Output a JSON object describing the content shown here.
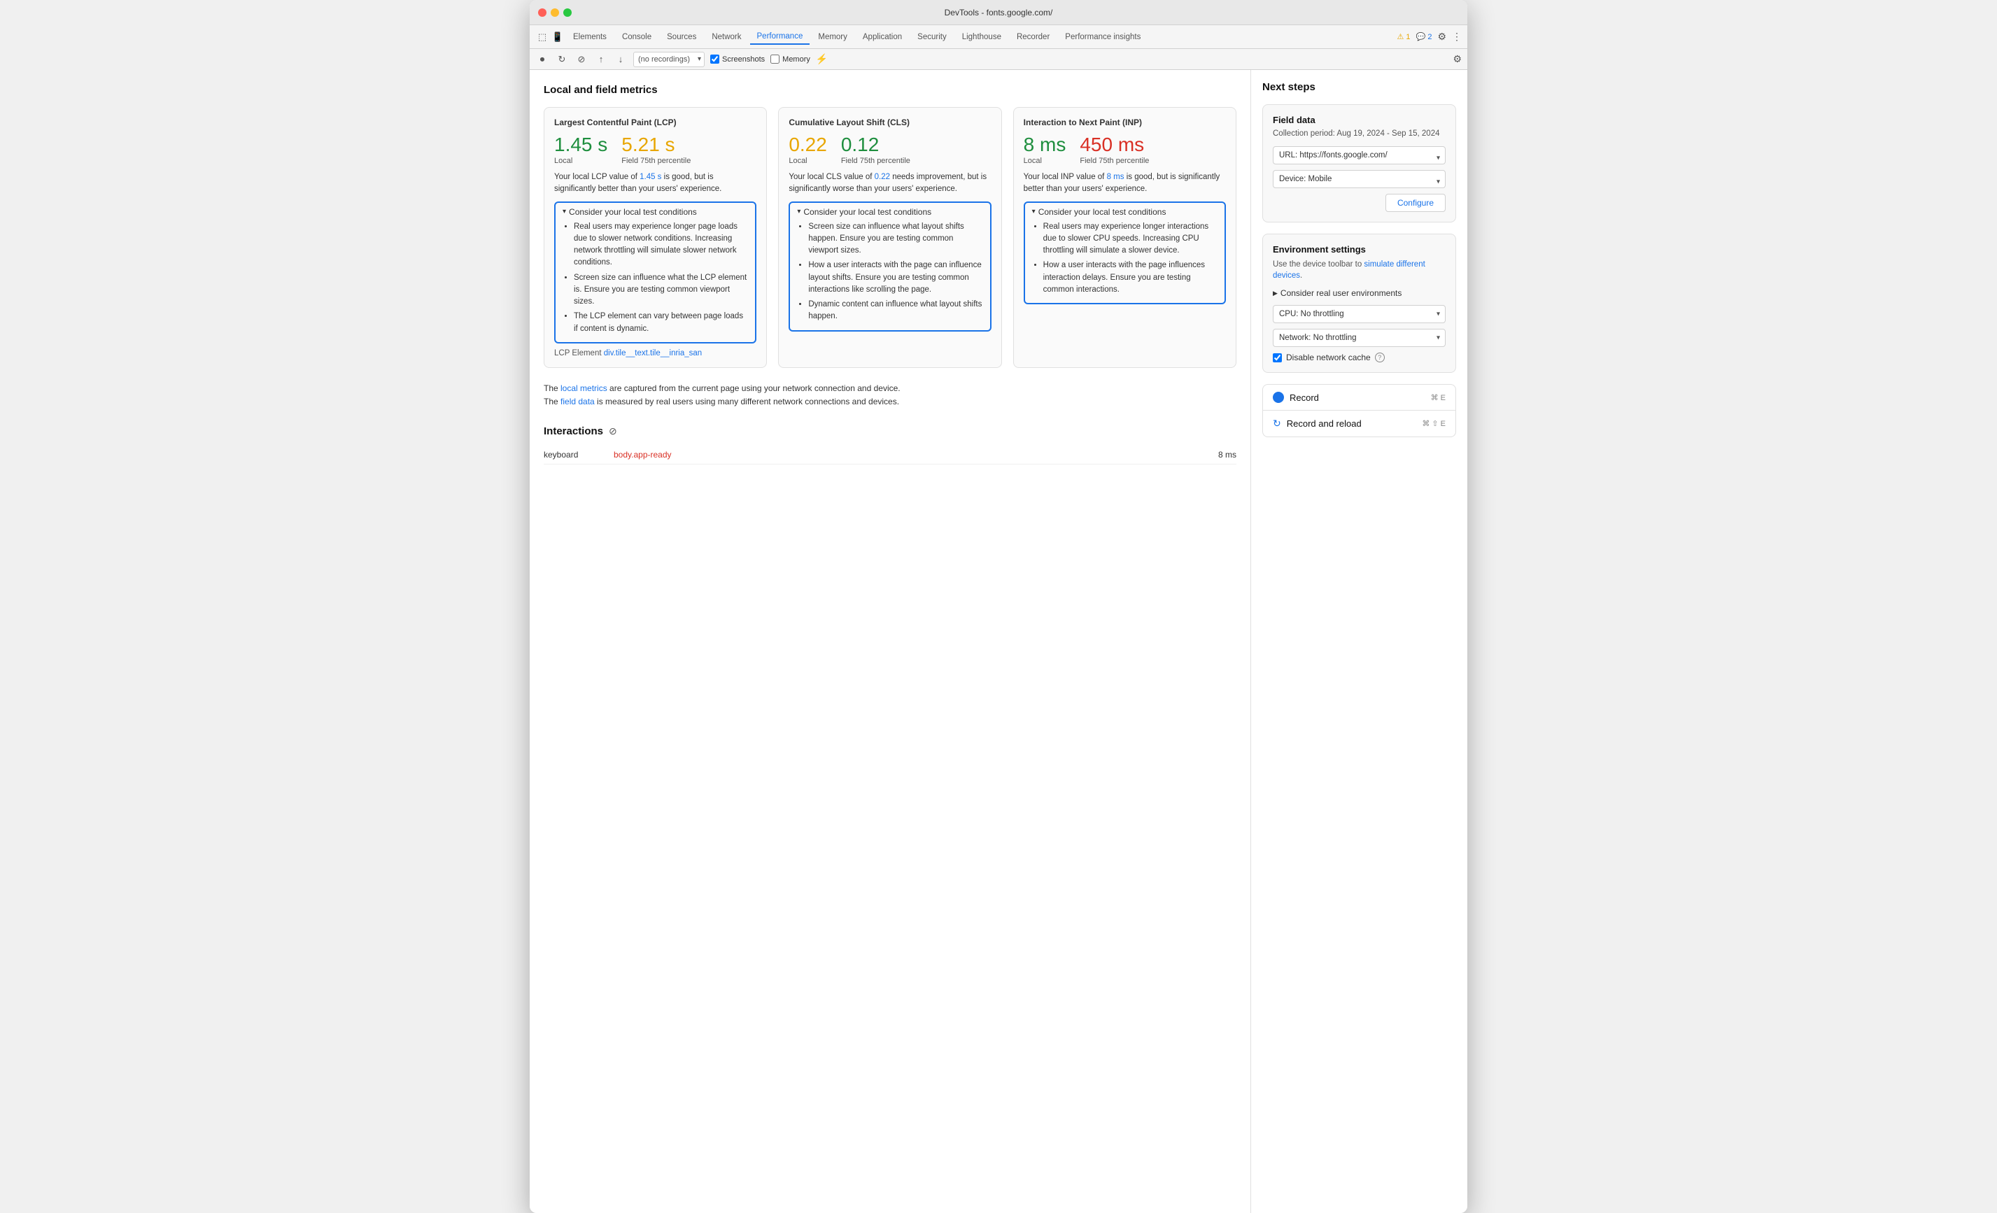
{
  "window": {
    "title": "DevTools - fonts.google.com/"
  },
  "titlebar": {
    "dots": [
      "red",
      "yellow",
      "green"
    ]
  },
  "devtools_nav": {
    "tabs": [
      {
        "label": "Elements",
        "active": false
      },
      {
        "label": "Console",
        "active": false
      },
      {
        "label": "Sources",
        "active": false
      },
      {
        "label": "Network",
        "active": false
      },
      {
        "label": "Performance",
        "active": true
      },
      {
        "label": "Memory",
        "active": false
      },
      {
        "label": "Application",
        "active": false
      },
      {
        "label": "Security",
        "active": false
      },
      {
        "label": "Lighthouse",
        "active": false
      },
      {
        "label": "Recorder",
        "active": false
      },
      {
        "label": "Performance insights",
        "active": false
      }
    ],
    "warnings": "⚠ 1",
    "messages": "💬 2"
  },
  "toolbar": {
    "recordings_placeholder": "(no recordings)",
    "screenshots_label": "Screenshots",
    "memory_label": "Memory"
  },
  "page_title": "Local and field metrics",
  "metrics": [
    {
      "id": "lcp",
      "title": "Largest Contentful Paint (LCP)",
      "local_value": "1.45 s",
      "local_value_class": "good",
      "field_value": "5.21 s",
      "field_value_class": "needs-improvement",
      "local_label": "Local",
      "field_label": "Field 75th percentile",
      "description": "Your local LCP value of 1.45 s is good, but is significantly better than your users' experience.",
      "description_highlight": "1.45 s",
      "consider_header": "Consider your local test conditions",
      "consider_items": [
        "Real users may experience longer page loads due to slower network conditions. Increasing network throttling will simulate slower network conditions.",
        "Screen size can influence what the LCP element is. Ensure you are testing common viewport sizes.",
        "The LCP element can vary between page loads if content is dynamic."
      ],
      "lcp_element_prefix": "LCP Element",
      "lcp_element_value": "div.tile__text.tile__inria_san"
    },
    {
      "id": "cls",
      "title": "Cumulative Layout Shift (CLS)",
      "local_value": "0.22",
      "local_value_class": "needs-improvement",
      "field_value": "0.12",
      "field_value_class": "good",
      "local_label": "Local",
      "field_label": "Field 75th percentile",
      "description": "Your local CLS value of 0.22 needs improvement, but is significantly worse than your users' experience.",
      "description_highlight": "0.22",
      "consider_header": "Consider your local test conditions",
      "consider_items": [
        "Screen size can influence what layout shifts happen. Ensure you are testing common viewport sizes.",
        "How a user interacts with the page can influence layout shifts. Ensure you are testing common interactions like scrolling the page.",
        "Dynamic content can influence what layout shifts happen."
      ]
    },
    {
      "id": "inp",
      "title": "Interaction to Next Paint (INP)",
      "local_value": "8 ms",
      "local_value_class": "good",
      "field_value": "450 ms",
      "field_value_class": "poor",
      "local_label": "Local",
      "field_label": "Field 75th percentile",
      "description": "Your local INP value of 8 ms is good, but is significantly better than your users' experience.",
      "description_highlight": "8 ms",
      "consider_header": "Consider your local test conditions",
      "consider_items": [
        "Real users may experience longer interactions due to slower CPU speeds. Increasing CPU throttling will simulate a slower device.",
        "How a user interacts with the page influences interaction delays. Ensure you are testing common interactions."
      ]
    }
  ],
  "metrics_note": {
    "local_link_text": "local metrics",
    "local_text": "The local metrics are captured from the current page using your network connection and device.",
    "field_link_text": "field data",
    "field_text": "The field data is measured by real users using many different network connections and devices."
  },
  "interactions": {
    "title": "Interactions",
    "rows": [
      {
        "name": "keyboard",
        "selector": "body.app-ready",
        "time": "8 ms"
      }
    ]
  },
  "next_steps": {
    "title": "Next steps",
    "field_data": {
      "title": "Field data",
      "subtitle": "Collection period: Aug 19, 2024 - Sep 15, 2024",
      "url_options": [
        "URL: https://fonts.google.com/"
      ],
      "device_options": [
        "Device: Mobile"
      ],
      "configure_label": "Configure"
    },
    "environment": {
      "title": "Environment settings",
      "subtitle": "Use the device toolbar to simulate different devices.",
      "simulate_link": "simulate different devices",
      "consider_real_label": "Consider real user environments",
      "cpu_options": [
        "CPU: No throttling"
      ],
      "network_options": [
        "Network: No throttling"
      ],
      "disable_cache_label": "Disable network cache"
    },
    "record": {
      "label": "Record",
      "shortcut": "⌘ E",
      "reload_label": "Record and reload",
      "reload_shortcut": "⌘ ⇧ E"
    }
  }
}
